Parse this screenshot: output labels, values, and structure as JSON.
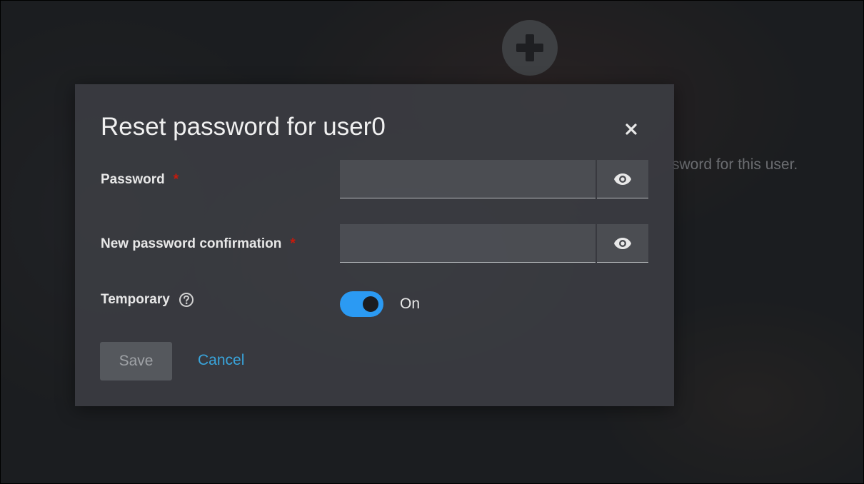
{
  "background": {
    "add_icon": "plus-circle-icon",
    "partial_text": "sword for this user."
  },
  "modal": {
    "title": "Reset password for user0",
    "close_icon": "close-icon",
    "fields": [
      {
        "label": "Password",
        "required_mark": "*",
        "value": "",
        "toggle_visibility_icon": "eye-icon"
      },
      {
        "label": "New password confirmation",
        "required_mark": "*",
        "value": "",
        "toggle_visibility_icon": "eye-icon"
      }
    ],
    "temporary": {
      "label": "Temporary",
      "help_icon": "question-circle-icon",
      "state_label": "On",
      "enabled": true
    },
    "buttons": {
      "save": "Save",
      "cancel": "Cancel"
    }
  },
  "colors": {
    "accent": "#2b9af3",
    "link": "#39a5dc",
    "required": "#c9190b"
  }
}
